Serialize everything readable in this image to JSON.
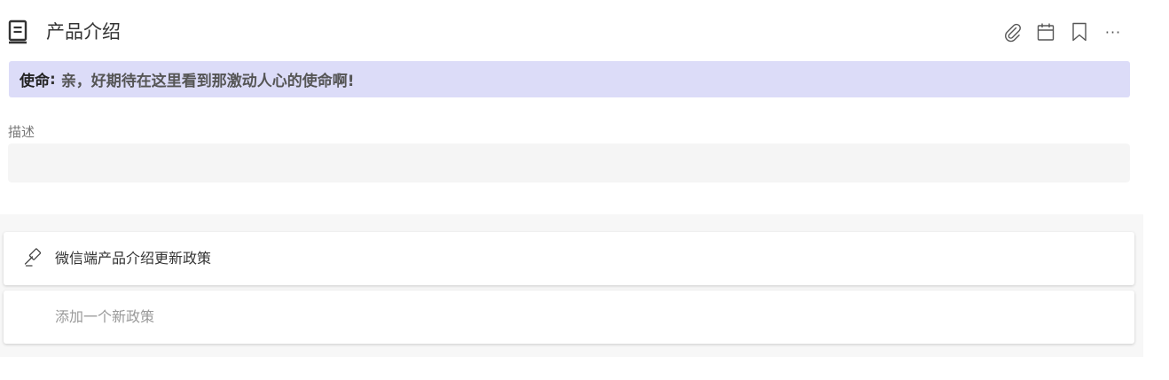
{
  "header": {
    "title": "产品介绍",
    "icons": [
      "document-icon",
      "paperclip-icon",
      "calendar-icon",
      "bookmark-icon",
      "more-icon"
    ],
    "more_glyph": "···"
  },
  "mission": {
    "label": "使命",
    "colon": ":",
    "text": "亲，好期待在这里看到那激动人心的使命啊!"
  },
  "description": {
    "label": "描述",
    "value": ""
  },
  "policies": {
    "items": [
      {
        "title": "微信端产品介绍更新政策",
        "icon": "gavel-icon"
      }
    ],
    "add_placeholder": "添加一个新政策"
  },
  "colors": {
    "mission_bg": "#dcdcf8",
    "panel_bg": "#f7f7f7",
    "desc_bg": "#f5f5f5"
  }
}
